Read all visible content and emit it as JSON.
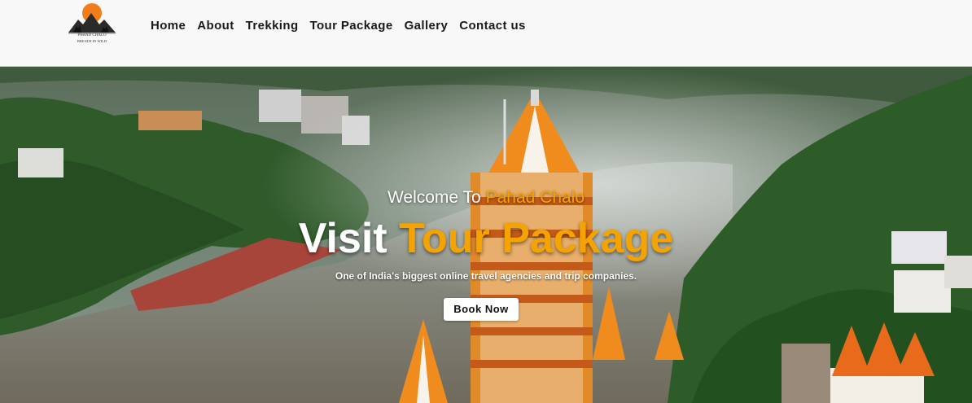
{
  "header": {
    "logo": {
      "name": "PAHAD CHALO",
      "tagline": "BREATH IN WILD",
      "icon": "mountain-sun-logo"
    },
    "nav": [
      {
        "label": "Home"
      },
      {
        "label": "About"
      },
      {
        "label": "Trekking"
      },
      {
        "label": "Tour Package"
      },
      {
        "label": "Gallery"
      },
      {
        "label": "Contact us"
      }
    ]
  },
  "hero": {
    "welcome_prefix": "Welcome To",
    "welcome_brand": "Pahad Chalo",
    "headline_white": "Visit",
    "headline_accent": "Tour Package",
    "tagline": "One of India's biggest online travel agencies and trip companies.",
    "button_label": "Book Now"
  },
  "colors": {
    "accent": "#f5a300",
    "header_bg": "#f8f8f8",
    "nav_text": "#1a1a1a"
  }
}
